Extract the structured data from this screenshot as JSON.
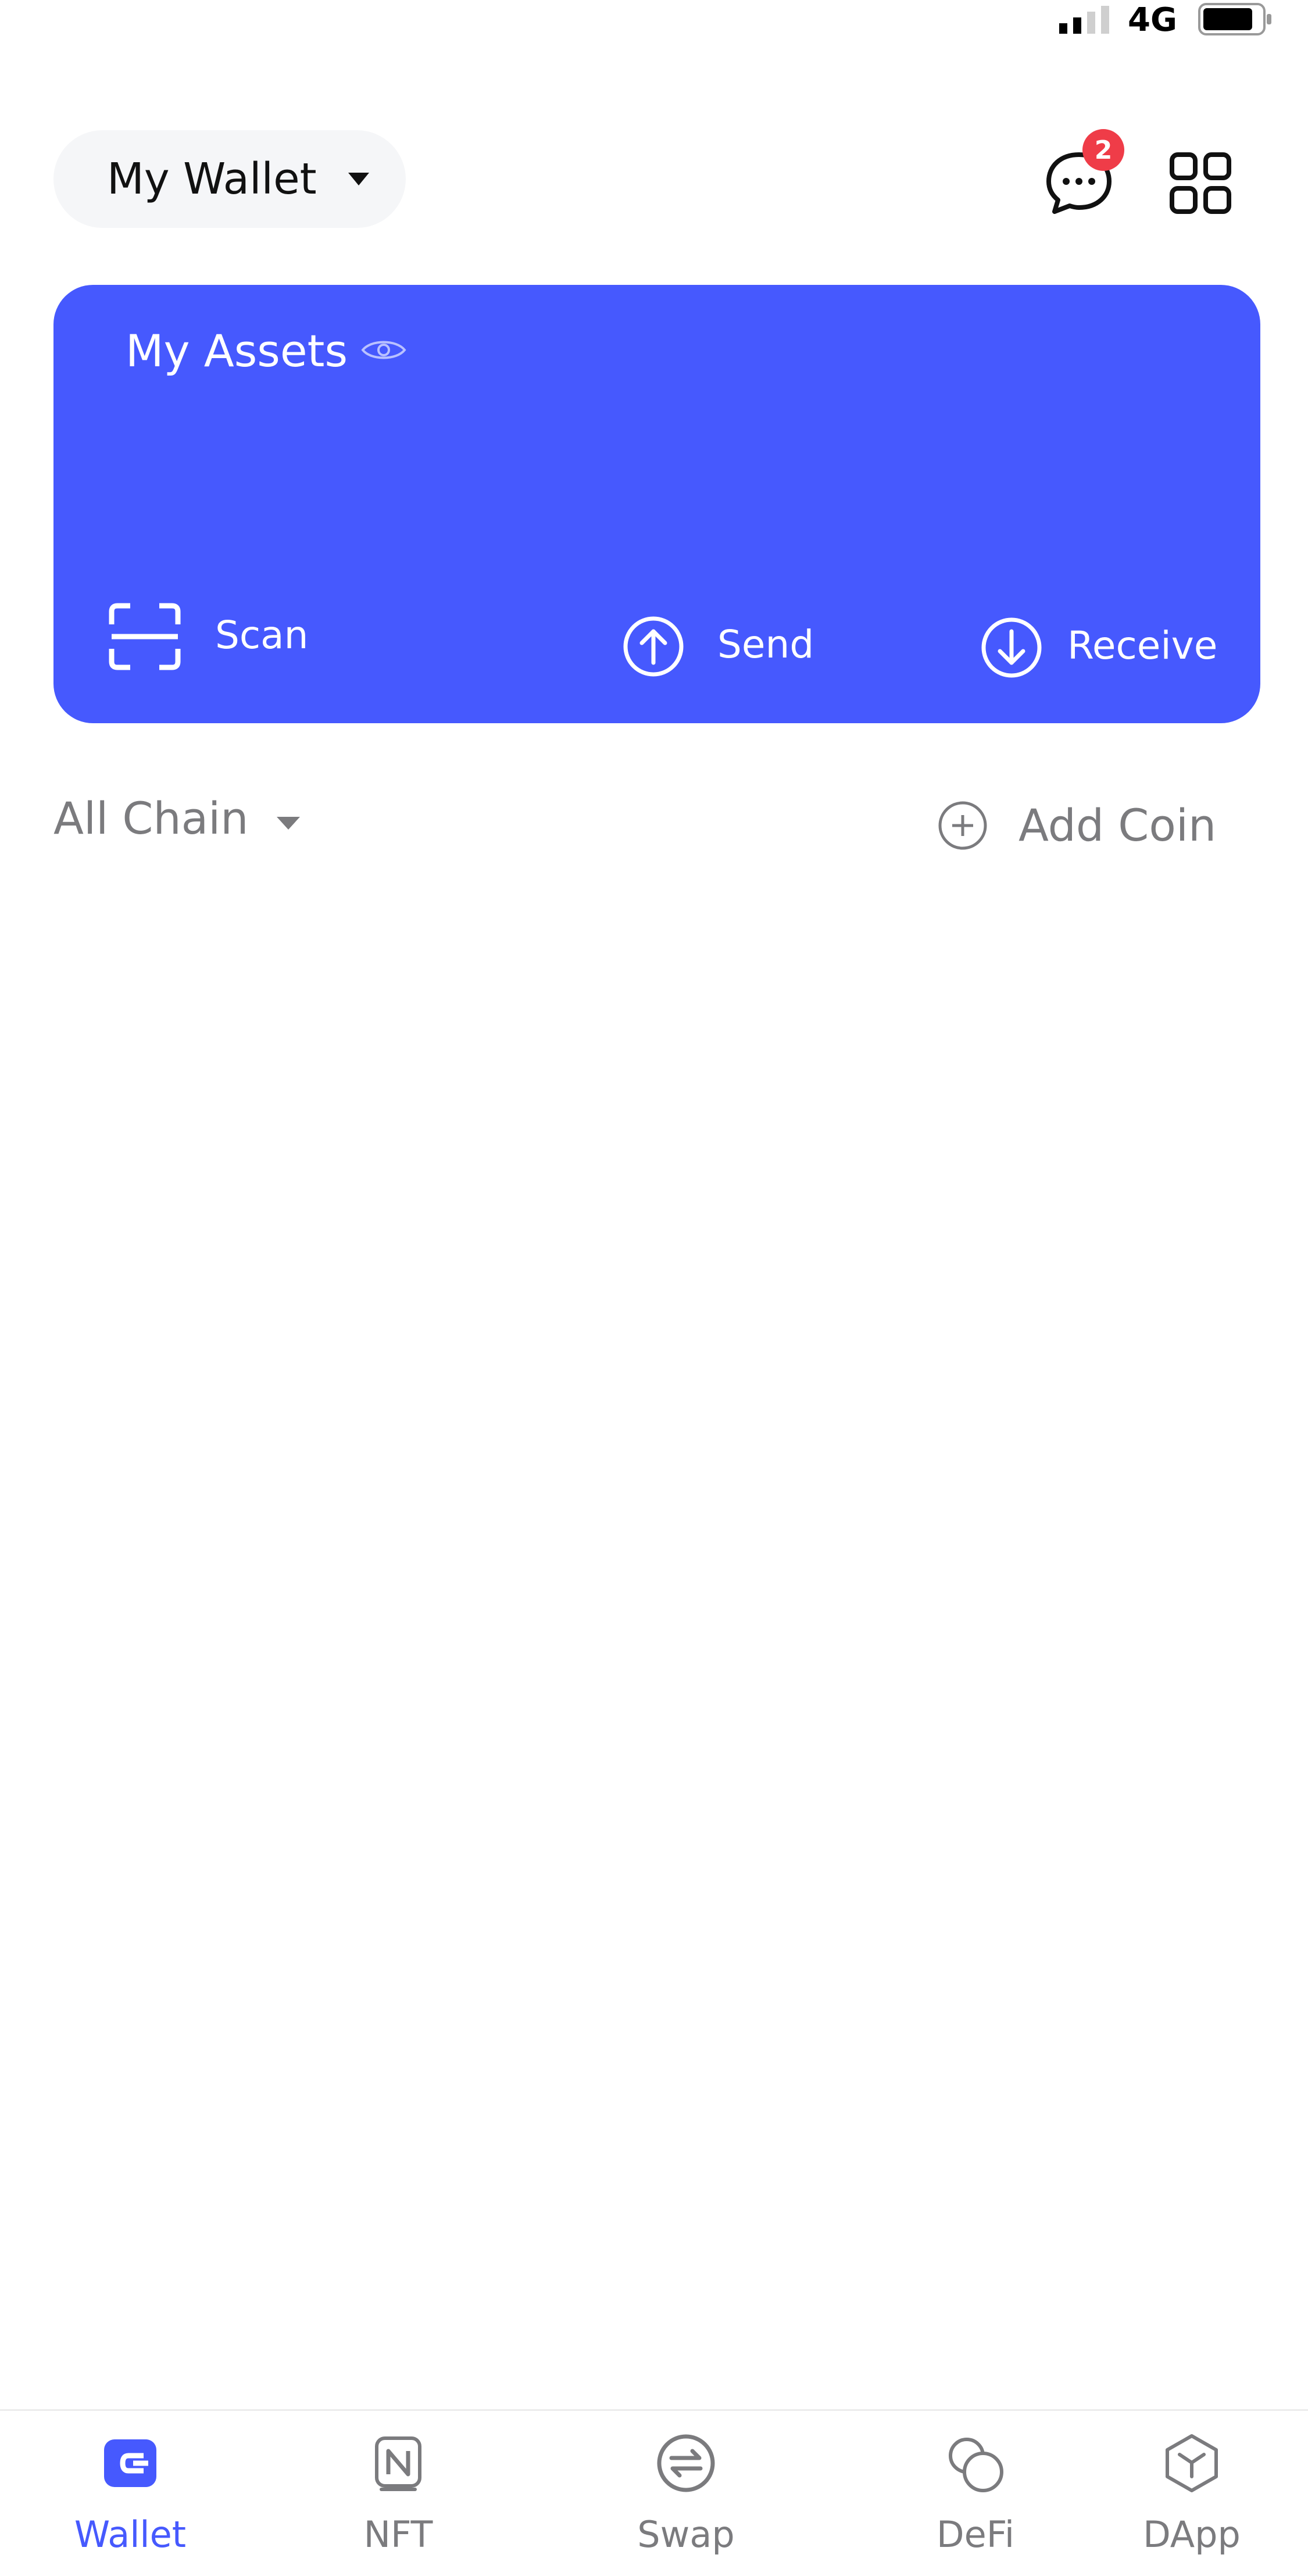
{
  "status_bar": {
    "network": "4G"
  },
  "header": {
    "wallet_name": "My Wallet",
    "notification_count": "2"
  },
  "assets_card": {
    "title": "My Assets",
    "actions": {
      "scan": "Scan",
      "send": "Send",
      "receive": "Receive"
    },
    "color": "#4659fe"
  },
  "filter": {
    "chain": "All Chain",
    "add_coin": "Add Coin"
  },
  "bottom_nav": {
    "items": [
      {
        "label": "Wallet",
        "icon": "wallet-icon",
        "active": true
      },
      {
        "label": "NFT",
        "icon": "nft-icon",
        "active": false
      },
      {
        "label": "Swap",
        "icon": "swap-icon",
        "active": false
      },
      {
        "label": "DeFi",
        "icon": "defi-icon",
        "active": false
      },
      {
        "label": "DApp",
        "icon": "dapp-icon",
        "active": false
      }
    ]
  },
  "colors": {
    "accent": "#4659fe",
    "badge": "#ef3c48",
    "muted_text": "#7b7b7e"
  }
}
